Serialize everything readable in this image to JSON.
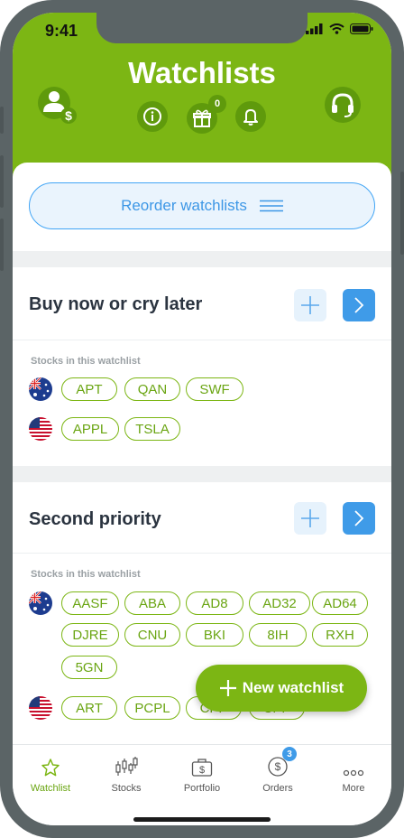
{
  "status_bar": {
    "time": "9:41"
  },
  "header": {
    "title": "Watchlists",
    "gift_count": "0",
    "icons": [
      "account-dollar-icon",
      "info-icon",
      "gift-icon",
      "bell-icon",
      "headset-icon"
    ]
  },
  "reorder": {
    "label": "Reorder watchlists"
  },
  "watchlists": [
    {
      "title": "Buy now or cry later",
      "subtitle": "Stocks in this watchlist",
      "au_stocks": [
        "APT",
        "QAN",
        "SWF"
      ],
      "us_stocks": [
        "APPL",
        "TSLA"
      ]
    },
    {
      "title": "Second priority",
      "subtitle": "Stocks in this watchlist",
      "au_stocks": [
        "AASF",
        "ABA",
        "AD8",
        "AD32",
        "AD64",
        "DJRE",
        "CNU",
        "BKI",
        "8IH",
        "RXH",
        "5GN"
      ],
      "us_stocks": [
        "ART",
        "PCPL",
        "CPP",
        "CPP"
      ]
    }
  ],
  "fab": {
    "label": "New watchlist"
  },
  "tabs": [
    {
      "label": "Watchlist",
      "icon": "star-icon",
      "active": true
    },
    {
      "label": "Stocks",
      "icon": "candlestick-icon",
      "active": false
    },
    {
      "label": "Portfolio",
      "icon": "briefcase-icon",
      "active": false
    },
    {
      "label": "Orders",
      "icon": "coin-icon",
      "active": false,
      "badge": "3"
    },
    {
      "label": "More",
      "icon": "more-icon",
      "active": false
    }
  ],
  "colors": {
    "brand_green": "#7cb614",
    "accent_blue": "#3f9be8"
  }
}
